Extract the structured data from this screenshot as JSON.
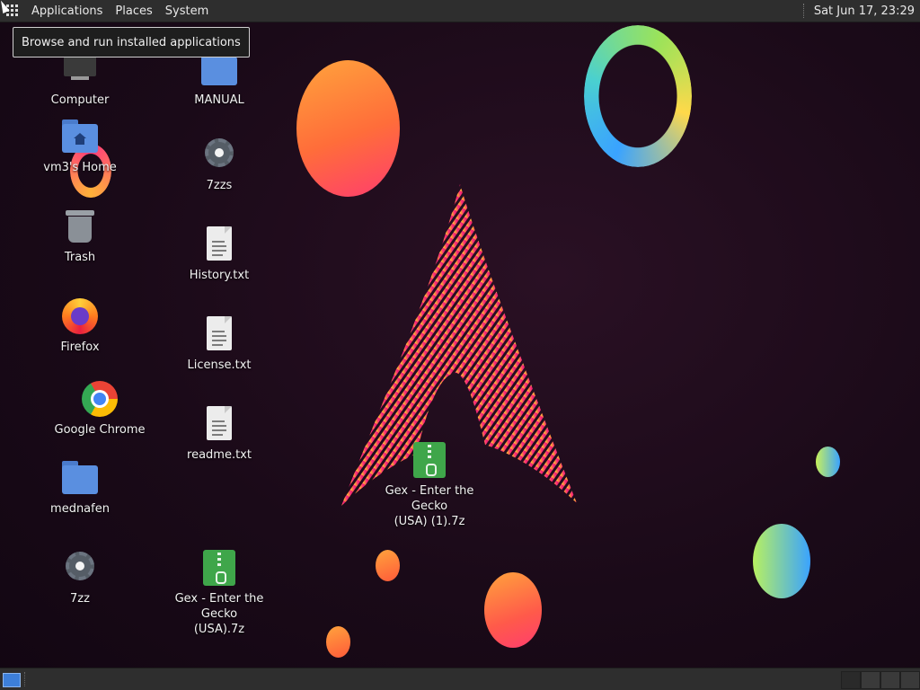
{
  "top_panel": {
    "menus": [
      "Applications",
      "Places",
      "System"
    ],
    "clock": "Sat Jun 17, 23:29"
  },
  "tooltip": "Browse and run installed applications",
  "desktop_icons": {
    "computer": "Computer",
    "manual": "MANUAL",
    "home": "vm3's Home",
    "sevenzzs": "7zzs",
    "trash": "Trash",
    "history": "History.txt",
    "firefox": "Firefox",
    "license": "License.txt",
    "chrome": "Google Chrome",
    "readme": "readme.txt",
    "mednafen": "mednafen",
    "gex1_line1": "Gex - Enter the Gecko",
    "gex1_line2": "(USA) (1).7z",
    "sevenzz": "7zz",
    "gex_line1": "Gex - Enter the Gecko",
    "gex_line2": "(USA).7z"
  }
}
